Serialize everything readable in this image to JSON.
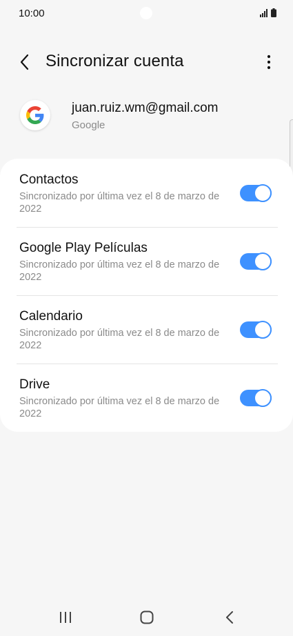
{
  "status_bar": {
    "time": "10:00",
    "icons": [
      "signal-icon",
      "battery-icon"
    ]
  },
  "header": {
    "title": "Sincronizar cuenta",
    "back_icon": "back-arrow-icon",
    "menu_icon": "more-vertical-icon"
  },
  "account": {
    "email": "juan.ruiz.wm@gmail.com",
    "type": "Google",
    "avatar_icon": "google-logo-icon"
  },
  "sync_items": [
    {
      "title": "Contactos",
      "subtitle": "Sincronizado por última vez el 8 de marzo de 2022",
      "enabled": true
    },
    {
      "title": "Google Play Películas",
      "subtitle": "Sincronizado por última vez el 8 de marzo de 2022",
      "enabled": true
    },
    {
      "title": "Calendario",
      "subtitle": "Sincronizado por última vez el 8 de marzo de 2022",
      "enabled": true
    },
    {
      "title": "Drive",
      "subtitle": "Sincronizado por última vez el 8 de marzo de 2022",
      "enabled": true
    }
  ],
  "nav_bar": {
    "icons": [
      "recents-icon",
      "home-icon",
      "back-icon"
    ]
  },
  "colors": {
    "accent": "#3e91ff",
    "background": "#f6f6f6",
    "card": "#ffffff",
    "secondary_text": "#8a8a8a"
  }
}
